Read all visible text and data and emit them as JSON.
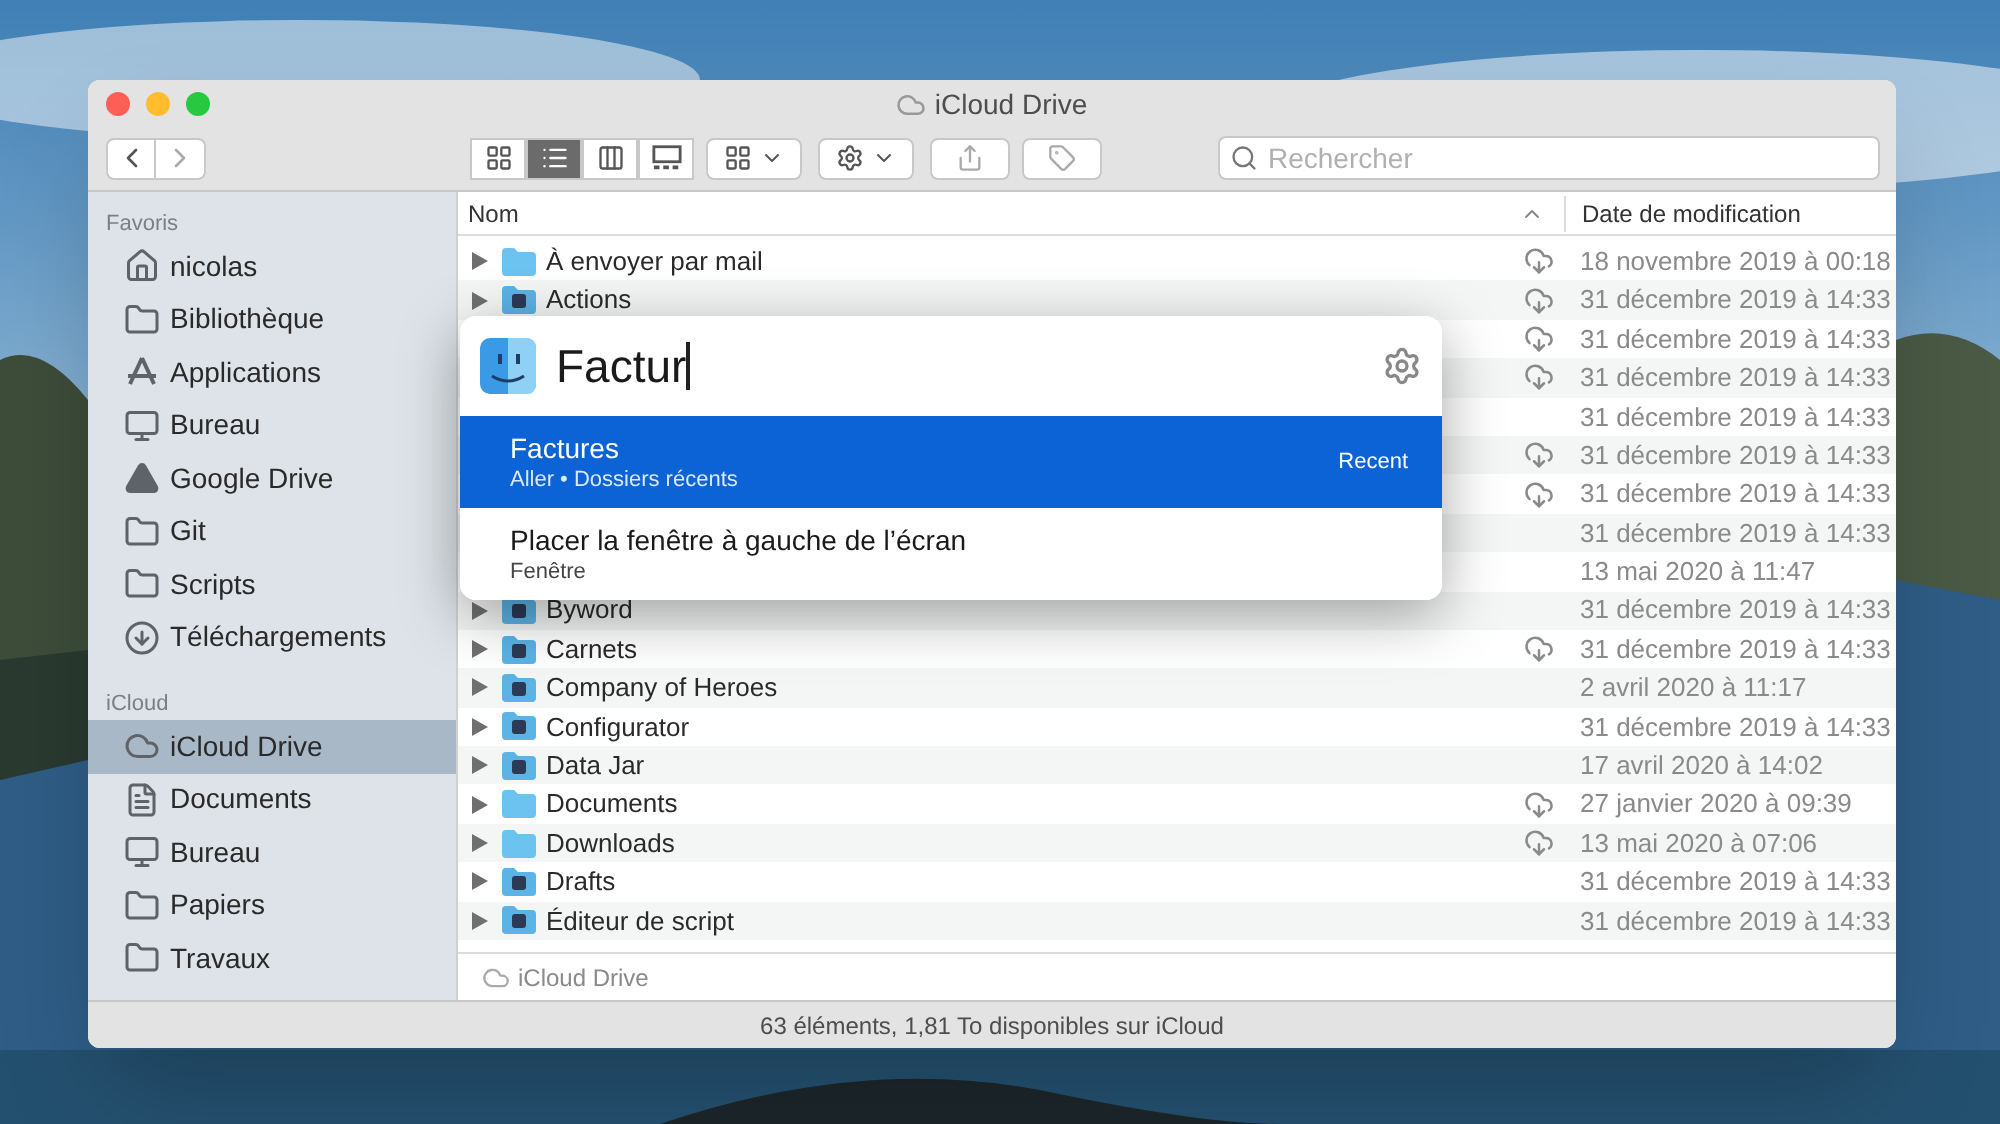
{
  "window": {
    "title": "iCloud Drive"
  },
  "toolbar": {
    "views": [
      {
        "kind": "icons",
        "selected": false
      },
      {
        "kind": "list",
        "selected": true
      },
      {
        "kind": "columns",
        "selected": false
      },
      {
        "kind": "gallery",
        "selected": false
      }
    ],
    "search": {
      "placeholder": "Rechercher"
    }
  },
  "sidebar": {
    "sections": [
      {
        "title": "Favoris",
        "items": [
          {
            "label": "nicolas",
            "kind": "home",
            "selected": false
          },
          {
            "label": "Bibliothèque",
            "kind": "folder",
            "selected": false
          },
          {
            "label": "Applications",
            "kind": "apps",
            "selected": false
          },
          {
            "label": "Bureau",
            "kind": "desktop",
            "selected": false
          },
          {
            "label": "Google Drive",
            "kind": "drive",
            "selected": false
          },
          {
            "label": "Git",
            "kind": "folder",
            "selected": false
          },
          {
            "label": "Scripts",
            "kind": "folder",
            "selected": false
          },
          {
            "label": "Téléchargements",
            "kind": "download",
            "selected": false
          }
        ]
      },
      {
        "title": "iCloud",
        "items": [
          {
            "label": "iCloud Drive",
            "kind": "cloud",
            "selected": true
          },
          {
            "label": "Documents",
            "kind": "document",
            "selected": false
          },
          {
            "label": "Bureau",
            "kind": "desktop",
            "selected": false
          },
          {
            "label": "Papiers",
            "kind": "folder",
            "selected": false
          },
          {
            "label": "Travaux",
            "kind": "folder",
            "selected": false
          }
        ]
      }
    ]
  },
  "table": {
    "columns": [
      "Nom",
      "Date de modification"
    ],
    "rows": [
      {
        "name": "À envoyer par mail",
        "kind": "folder",
        "in_cloud": true,
        "date": "18 novembre 2019 à 00:18"
      },
      {
        "name": "Actions",
        "kind": "app",
        "in_cloud": true,
        "date": "31 décembre 2019 à 14:33"
      },
      {
        "in_cloud": true,
        "date": "31 décembre 2019 à 14:33"
      },
      {
        "in_cloud": true,
        "date": "31 décembre 2019 à 14:33"
      },
      {
        "in_cloud": false,
        "date": "31 décembre 2019 à 14:33"
      },
      {
        "in_cloud": true,
        "date": "31 décembre 2019 à 14:33"
      },
      {
        "in_cloud": true,
        "date": "31 décembre 2019 à 14:33"
      },
      {
        "in_cloud": false,
        "date": "31 décembre 2019 à 14:33"
      },
      {
        "in_cloud": false,
        "date": "13 mai 2020 à 11:47"
      },
      {
        "name": "Byword",
        "kind": "app",
        "in_cloud": false,
        "date": "31 décembre 2019 à 14:33"
      },
      {
        "name": "Carnets",
        "kind": "app",
        "in_cloud": true,
        "date": "31 décembre 2019 à 14:33"
      },
      {
        "name": "Company of Heroes",
        "kind": "app",
        "in_cloud": false,
        "date": "2 avril 2020 à 11:17"
      },
      {
        "name": "Configurator",
        "kind": "app",
        "in_cloud": false,
        "date": "31 décembre 2019 à 14:33"
      },
      {
        "name": "Data Jar",
        "kind": "app",
        "in_cloud": false,
        "date": "17 avril 2020 à 14:02"
      },
      {
        "name": "Documents",
        "kind": "folder",
        "in_cloud": true,
        "date": "27 janvier 2020 à 09:39"
      },
      {
        "name": "Downloads",
        "kind": "folder",
        "in_cloud": true,
        "date": "13 mai 2020 à 07:06"
      },
      {
        "name": "Drafts",
        "kind": "app",
        "in_cloud": false,
        "date": "31 décembre 2019 à 14:33"
      },
      {
        "name": "Éditeur de script",
        "kind": "app",
        "in_cloud": false,
        "date": "31 décembre 2019 à 14:33"
      }
    ]
  },
  "path_bar": "iCloud Drive",
  "status_bar": "63 éléments, 1,81 To disponibles sur iCloud",
  "launcher": {
    "query": "Factur",
    "results": [
      {
        "title": "Factures",
        "subtitle": "Aller • Dossiers récents",
        "badge": "Recent",
        "selected": true
      },
      {
        "title": "Placer la fenêtre à gauche de l’écran",
        "subtitle": "Fenêtre",
        "selected": false
      }
    ]
  }
}
